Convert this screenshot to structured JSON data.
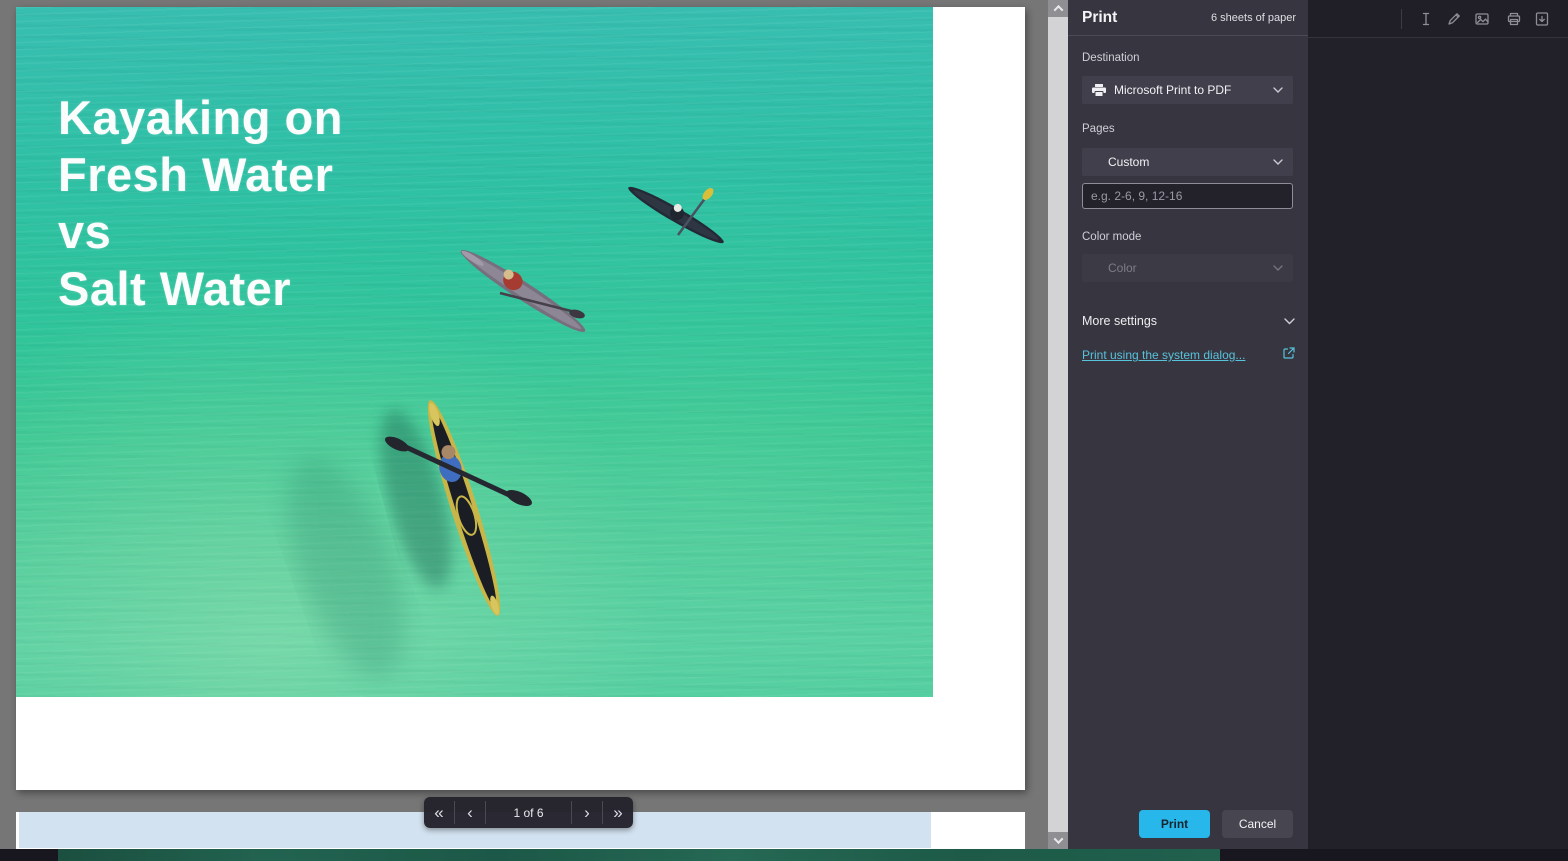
{
  "preview": {
    "slide_title_lines": [
      "Kayaking on",
      "Fresh Water",
      "vs",
      "Salt Water"
    ],
    "nav": {
      "first": "«",
      "previous": "‹",
      "page_indicator": "1 of 6",
      "next": "›",
      "last": "»"
    }
  },
  "print_panel": {
    "title": "Print",
    "sheets_summary": "6 sheets of paper",
    "destination_label": "Destination",
    "destination_value": "Microsoft Print to PDF",
    "pages_label": "Pages",
    "pages_value": "Custom",
    "custom_pages_placeholder": "e.g. 2-6, 9, 12-16",
    "color_mode_label": "Color mode",
    "color_mode_value": "Color",
    "more_settings_label": "More settings",
    "system_dialog_link": "Print using the system dialog...",
    "print_button_label": "Print",
    "cancel_button_label": "Cancel"
  },
  "toolbar_icons": [
    "text-cursor-icon",
    "pen-icon",
    "image-icon",
    "printer-icon",
    "save-icon"
  ],
  "colors": {
    "accent_cyan": "#28b7ea",
    "link_teal": "#57c3dc",
    "panel_bg": "#37353f",
    "viewer_bg": "#22212a",
    "water_top": "#38beb0",
    "water_bottom": "#53cea0"
  }
}
